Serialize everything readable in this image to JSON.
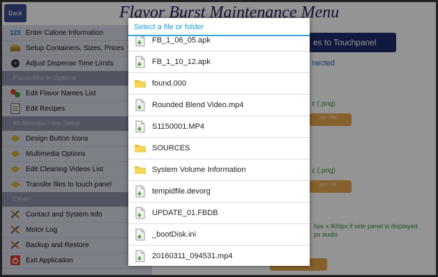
{
  "header": {
    "back_label": "Back",
    "title": "Flavor Burst Maintenance Menu"
  },
  "sidebar": {
    "items": [
      {
        "label": "Enter Calorie Information",
        "icon": "123-icon"
      },
      {
        "label": "Setup Containers, Sizes, Prices",
        "icon": "containers-icon"
      },
      {
        "label": "Adjust Dispense Time Limits",
        "icon": "timer-icon"
      },
      {
        "label": "Edit Flavor Names List",
        "icon": "flavors-icon"
      },
      {
        "label": "Edit Recipes",
        "icon": "recipe-icon"
      },
      {
        "label": "Design Button Icons",
        "icon": "design-icon"
      },
      {
        "label": "Multimedia Options",
        "icon": "multimedia-icon"
      },
      {
        "label": "Edit Cleaning Videos List",
        "icon": "cleaning-icon"
      },
      {
        "label": "Transfer files to touch panel",
        "icon": "transfer-icon"
      },
      {
        "label": "Contact and System Info",
        "icon": "tools-icon"
      },
      {
        "label": "Motor Log",
        "icon": "tools-icon"
      },
      {
        "label": "Backup and Restore",
        "icon": "tools-icon"
      },
      {
        "label": "Exit Application",
        "icon": "power-icon"
      }
    ],
    "sections": [
      "Flavor/Mix-In Options",
      "Multimedia Files Setup",
      "Other"
    ]
  },
  "main": {
    "button_label": "es to Touchpanel",
    "connected": "nected",
    "png1": "c (.png)",
    "png2": "c (.png)",
    "upload1": "age File",
    "upload2": "age File",
    "note1": "6px x 800px if side panel is displayed",
    "note2": "ps audio"
  },
  "dialog": {
    "title": "Select a file or folder",
    "items": [
      {
        "name": "FB_1_06_05.apk",
        "type": "file"
      },
      {
        "name": "FB_1_10_12.apk",
        "type": "file"
      },
      {
        "name": "found.000",
        "type": "folder"
      },
      {
        "name": "Rounded Blend Video.mp4",
        "type": "file"
      },
      {
        "name": "S1150001.MP4",
        "type": "file"
      },
      {
        "name": "SOURCES",
        "type": "folder"
      },
      {
        "name": "System Volume Information",
        "type": "folder"
      },
      {
        "name": "tempidfile.devorg",
        "type": "file"
      },
      {
        "name": "UPDATE_01.FBDB",
        "type": "file"
      },
      {
        "name": "_bootDisk.ini",
        "type": "file"
      },
      {
        "name": "20160311_094531.mp4",
        "type": "file"
      }
    ]
  },
  "colors": {
    "accent": "#2fa6de",
    "header_button": "#3d4d8f",
    "section": "#8e92a8",
    "sidebar": "#dadde8"
  }
}
